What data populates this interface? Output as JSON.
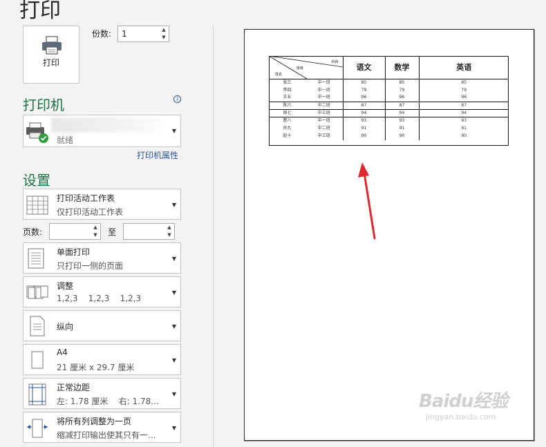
{
  "page_title": "打印",
  "print_button": {
    "label": "打印"
  },
  "copies": {
    "label": "份数:",
    "value": "1"
  },
  "printer": {
    "section_title": "打印机",
    "status": "就绪",
    "properties_link": "打印机属性"
  },
  "settings": {
    "section_title": "设置",
    "what": {
      "title": "打印活动工作表",
      "sub": "仅打印活动工作表"
    },
    "pages": {
      "label": "页数:",
      "to_label": "至",
      "from_value": "",
      "to_value": ""
    },
    "sides": {
      "title": "单面打印",
      "sub": "只打印一侧的页面"
    },
    "collate": {
      "title": "调整",
      "sub": "1,2,3    1,2,3    1,2,3"
    },
    "orientation": {
      "title": "纵向"
    },
    "paper_size": {
      "title": "A4",
      "sub": "21 厘米 x 29.7 厘米"
    },
    "margins": {
      "title": "正常边距",
      "sub": "左: 1.78 厘米    右: 1.78..."
    },
    "scaling": {
      "title": "将所有列调整为一页",
      "sub": "缩减打印输出使其只有一..."
    }
  },
  "preview": {
    "corner": {
      "top": "科目",
      "mid": "班级",
      "bottom": "姓名"
    },
    "headers": [
      "语文",
      "数学",
      "英语"
    ],
    "rows": [
      [
        "张三",
        "中一班",
        "85",
        "85",
        "85"
      ],
      [
        "李四",
        "中一班",
        "79",
        "79",
        "79"
      ],
      [
        "王五",
        "中一班",
        "96",
        "96",
        "96"
      ],
      [
        "陈六",
        "中二班",
        "87",
        "87",
        "87"
      ],
      [
        "周七",
        "中三班",
        "94",
        "94",
        "94"
      ],
      [
        "楚八",
        "中一班",
        "93",
        "93",
        "93"
      ],
      [
        "孙九",
        "中二班",
        "91",
        "91",
        "91"
      ],
      [
        "赵十",
        "中三班",
        "90",
        "90",
        "90"
      ]
    ]
  },
  "watermark": {
    "brand": "Baidu经验",
    "url": "jingyan.baidu.com"
  }
}
